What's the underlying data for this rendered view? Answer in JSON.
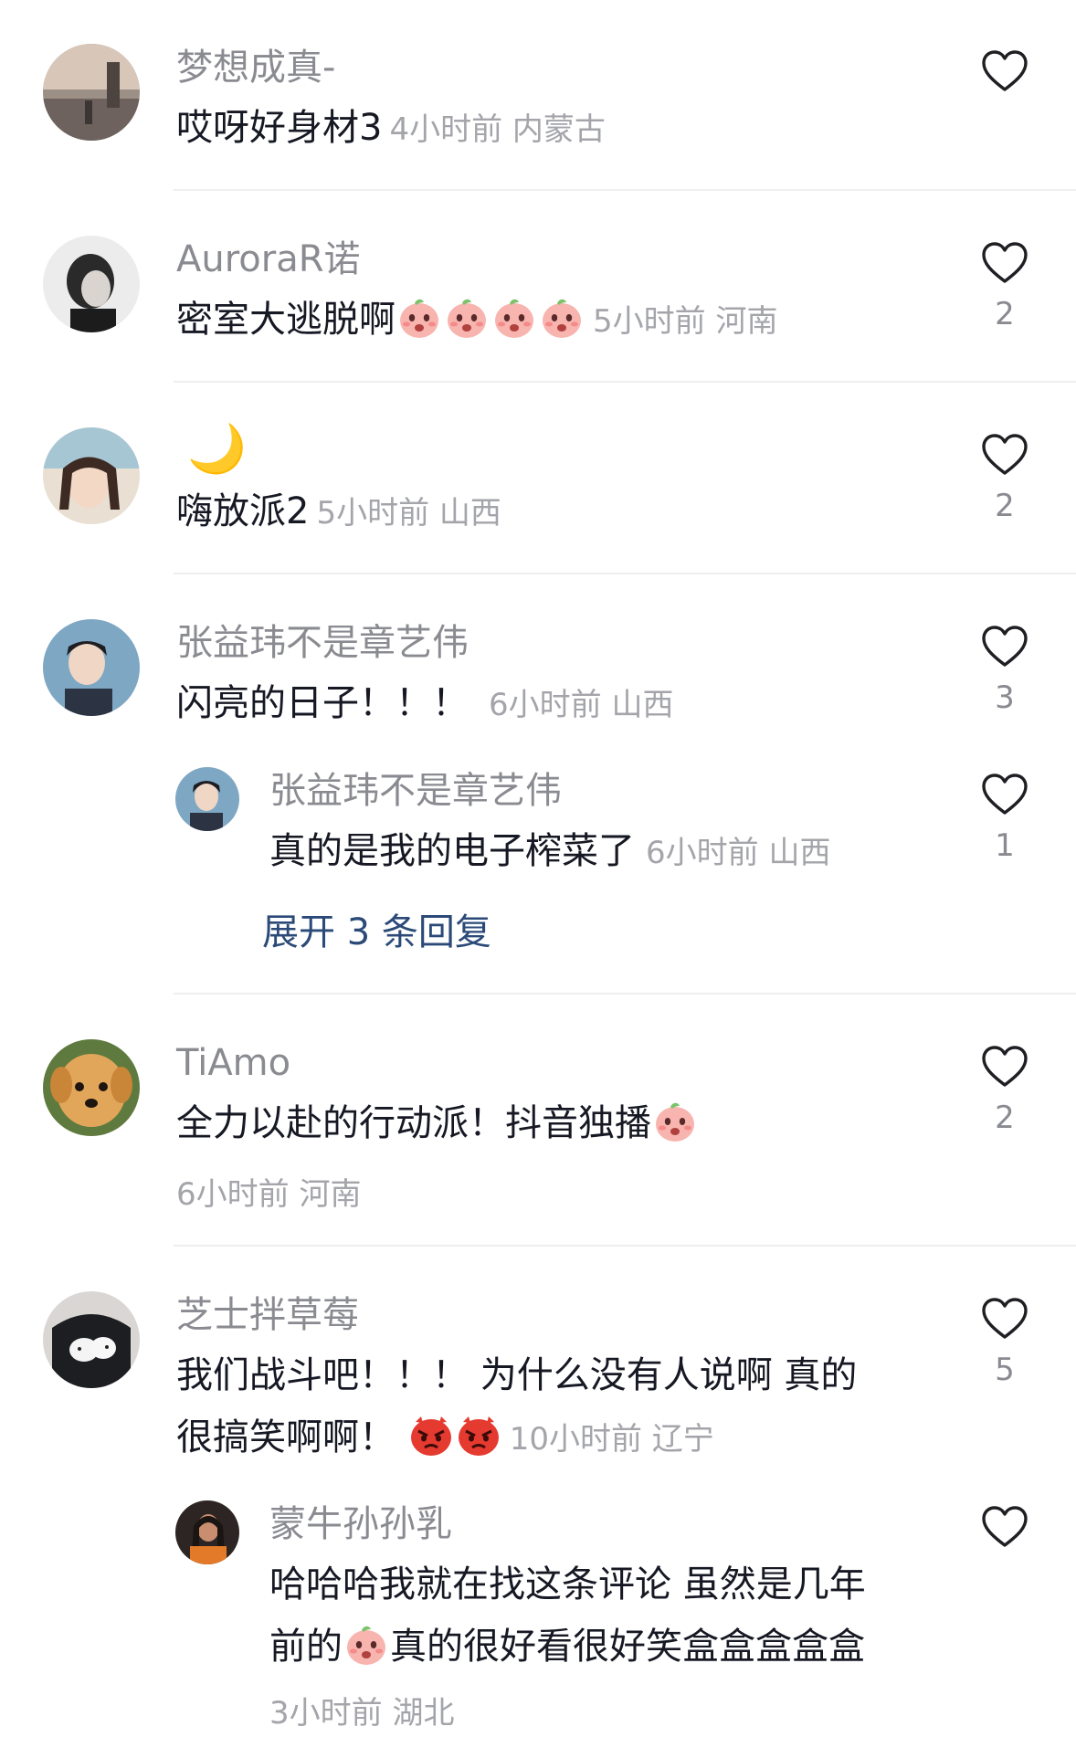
{
  "comments": [
    {
      "username": "梦想成真-",
      "text": "哎呀好身材3",
      "meta": "4小时前 内蒙古",
      "likes": ""
    },
    {
      "username": "AuroraR诺",
      "text": "密室大逃脱啊",
      "meta": "5小时前 河南",
      "likes": "2"
    },
    {
      "username": "🌙",
      "text": "嗨放派2",
      "meta": "5小时前 山西",
      "likes": "2"
    },
    {
      "username": "张益玮不是章艺伟",
      "text": "闪亮的日子！！！",
      "meta": "6小时前 山西",
      "likes": "3",
      "reply": {
        "username": "张益玮不是章艺伟",
        "text": "真的是我的电子榨菜了",
        "meta": "6小时前 山西",
        "likes": "1"
      },
      "expand_label": "展开 3 条回复"
    },
    {
      "username": "TiAmo",
      "text": "全力以赴的行动派！抖音独播",
      "meta": "6小时前 河南",
      "likes": "2"
    },
    {
      "username": "芝士拌草莓",
      "text_line1": "我们战斗吧！！！ 为什么没有人说啊  真的",
      "text_line2": "很搞笑啊啊！",
      "meta": "10小时前 辽宁",
      "likes": "5",
      "reply": {
        "username": "蒙牛孙孙乳",
        "text_line1": "哈哈哈我就在找这条评论 虽然是几年",
        "text_line2_a": "前的",
        "text_line2_b": "真的很好看很好笑盒盒盒盒盒",
        "meta": "3小时前 湖北",
        "likes": ""
      }
    }
  ],
  "icons": {
    "like": "heart-outline-icon",
    "emoji_peach": "peach-face-emoji",
    "emoji_angry": "angry-red-face-emoji"
  },
  "colors": {
    "username": "#8a8b91",
    "body": "#161823",
    "meta": "#a4a5aa",
    "expand": "#2b4a78",
    "divider": "#efefef"
  }
}
